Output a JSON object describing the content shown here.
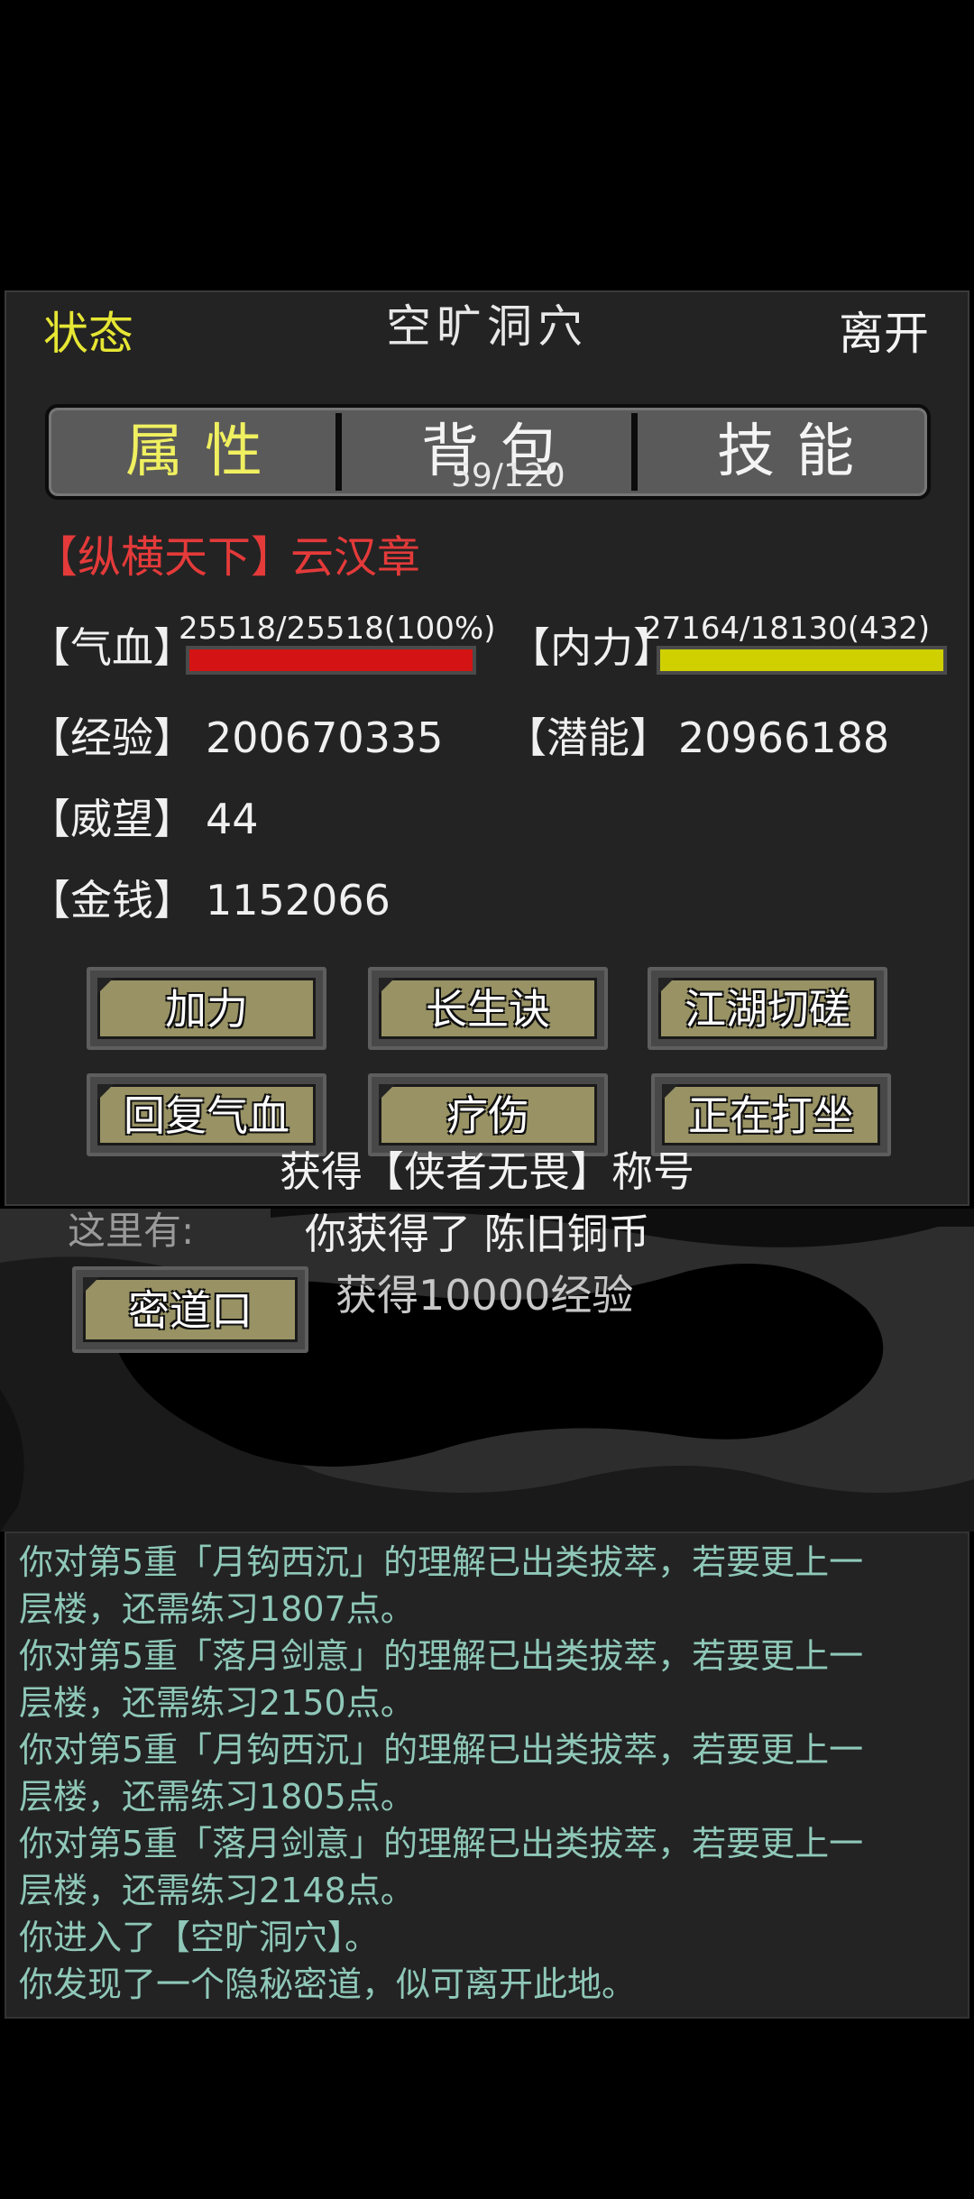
{
  "header": {
    "status_tab": "状态",
    "location_title": "空旷洞穴",
    "leave_button": "离开"
  },
  "tabs": [
    {
      "label": "属性",
      "active": true
    },
    {
      "label": "背包",
      "count": "59/120"
    },
    {
      "label": "技能"
    }
  ],
  "character": {
    "title": "【纵横天下】",
    "name": "云汉章"
  },
  "stats": {
    "hp_label": "【气血】",
    "hp_value": "25518/25518(100%)",
    "hp_fill": 1.0,
    "mp_label": "【内力】",
    "mp_value": "27164/18130(432)",
    "mp_fill": 1.0,
    "exp_label": "【经验】",
    "exp_value": "200670335",
    "potential_label": "【潜能】",
    "potential_value": "20966188",
    "prestige_label": "【威望】",
    "prestige_value": "44",
    "money_label": "【金钱】",
    "money_value": "1152066"
  },
  "action_buttons": [
    "加力",
    "长生诀",
    "江湖切磋",
    "回复气血",
    "疗伤",
    "正在打坐"
  ],
  "notice": "获得【侠者无畏】称号",
  "scene": {
    "here_label": "这里有:",
    "exit_button": "密道口",
    "message_1": "你获得了 陈旧铜币",
    "message_2": "获得10000经验"
  },
  "log": [
    "你对第5重「月钩西沉」的理解已出类拔萃，若要更上一",
    "层楼，还需练习1807点。",
    "你对第5重「落月剑意」的理解已出类拔萃，若要更上一",
    "层楼，还需练习2150点。",
    "你对第5重「月钩西沉」的理解已出类拔萃，若要更上一",
    "层楼，还需练习1805点。",
    "你对第5重「落月剑意」的理解已出类拔萃，若要更上一",
    "层楼，还需练习2148点。",
    "你进入了【空旷洞穴】。",
    "你发现了一个隐秘密道，似可离开此地。"
  ],
  "colors": {
    "hp_bar": "#d41414",
    "mp_bar": "#d0d000",
    "accent_yellow": "#e6e634",
    "title_red": "#e43a3a",
    "log_text": "#8fc8b8"
  }
}
